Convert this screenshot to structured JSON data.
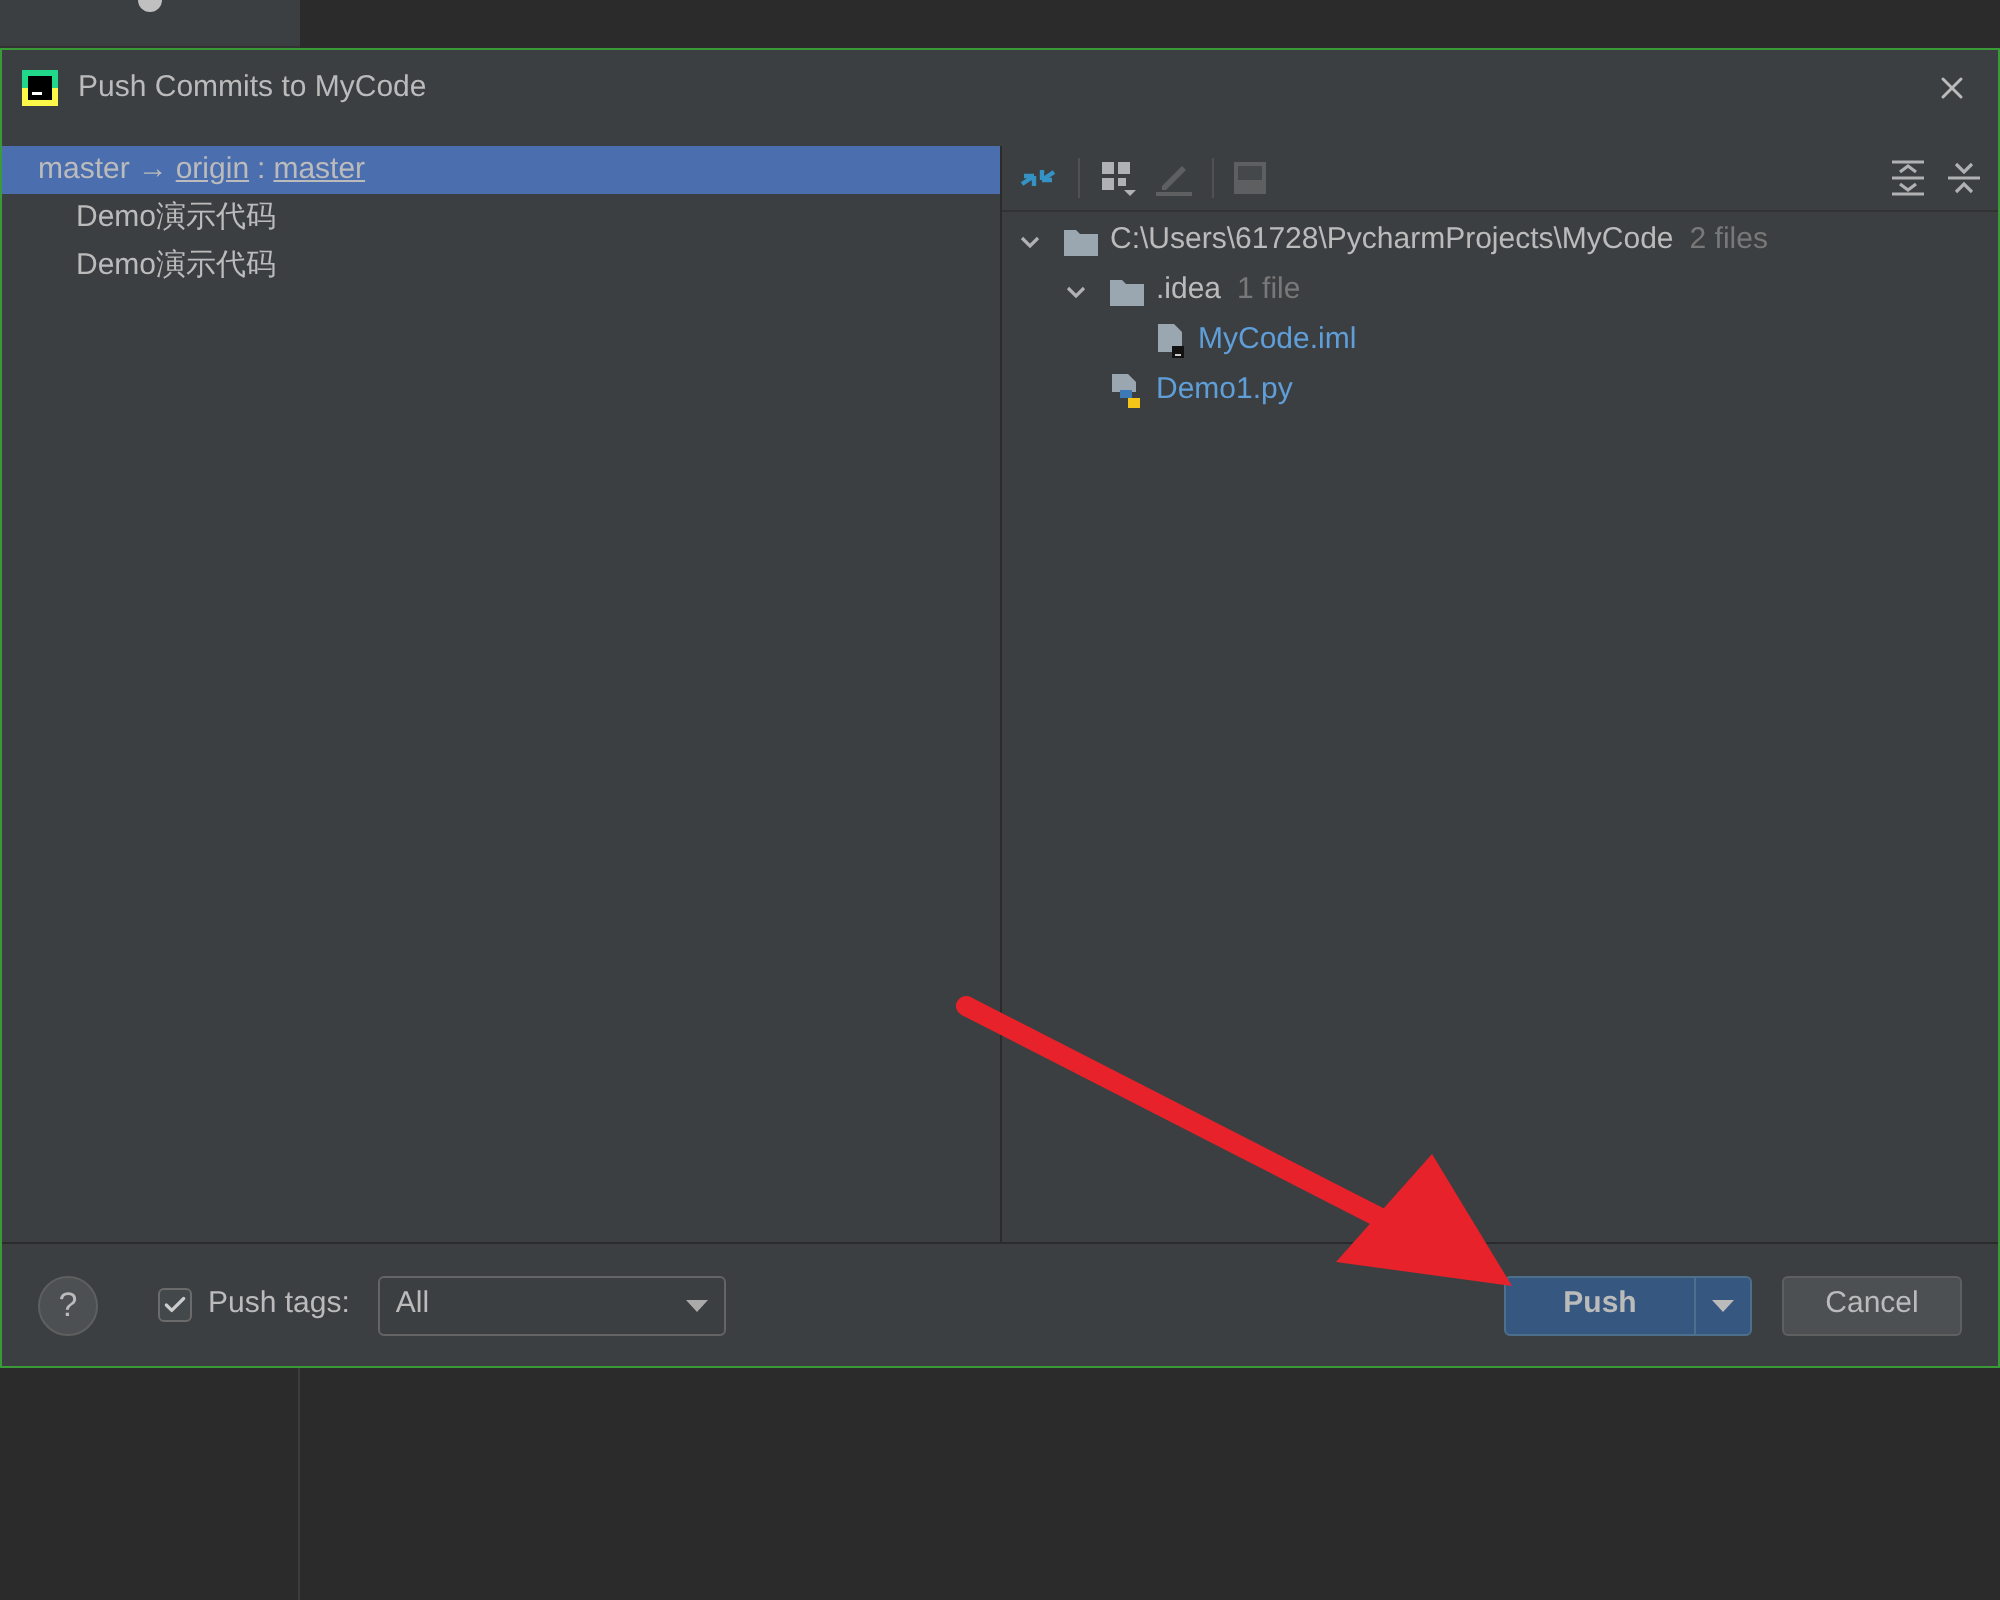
{
  "title": "Push Commits to MyCode",
  "branches": [
    {
      "source": "master",
      "arrow": "→",
      "remote": "origin",
      "separator": ":",
      "target": "master",
      "selected": true,
      "commits": [
        {
          "message": "Demo演示代码"
        },
        {
          "message": "Demo演示代码"
        }
      ]
    }
  ],
  "file_tree": [
    {
      "name": "C:\\Users\\61728\\PycharmProjects\\MyCode",
      "count": "2 files",
      "kind": "folder",
      "expanded": true,
      "children": [
        {
          "name": ".idea",
          "count": "1 file",
          "kind": "folder",
          "expanded": true,
          "children": [
            {
              "name": "MyCode.iml",
              "kind": "iml"
            }
          ]
        },
        {
          "name": "Demo1.py",
          "kind": "python"
        }
      ]
    }
  ],
  "footer": {
    "help": "?",
    "push_tags": {
      "label": "Push tags:",
      "checked": true
    },
    "tags_select": {
      "value": "All"
    },
    "buttons": [
      {
        "label": "Push",
        "kind": "primary"
      },
      {
        "label": "Cancel",
        "kind": "secondary"
      }
    ]
  }
}
